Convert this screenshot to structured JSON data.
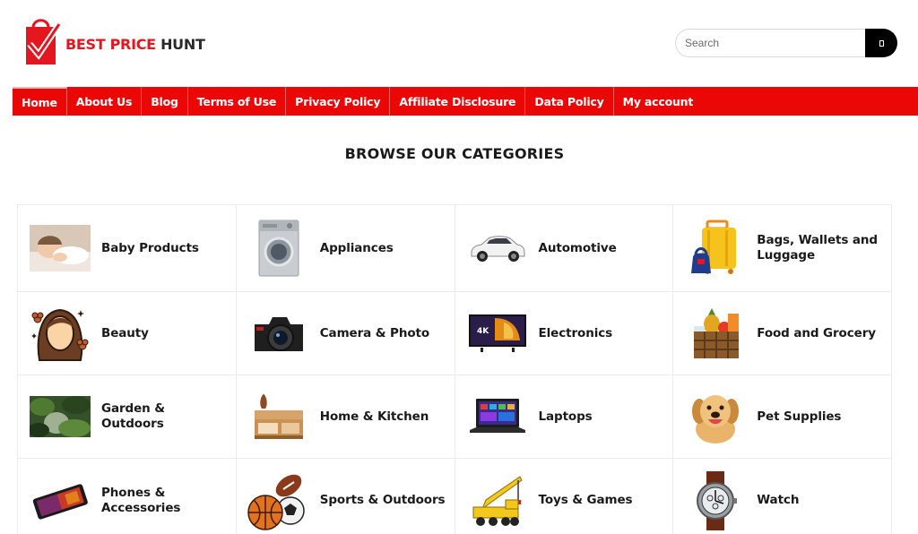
{
  "brand": {
    "name_part1": "BEST PRICE",
    "name_part2": "HUNT",
    "primary_color": "#ec0707"
  },
  "search": {
    "placeholder": "Search",
    "button_icon": "search-icon"
  },
  "nav": {
    "items": [
      {
        "label": "Home",
        "active": true
      },
      {
        "label": "About Us"
      },
      {
        "label": "Blog"
      },
      {
        "label": "Terms of Use"
      },
      {
        "label": "Privacy Policy"
      },
      {
        "label": "Affiliate Disclosure"
      },
      {
        "label": "Data Policy"
      },
      {
        "label": "My account"
      }
    ]
  },
  "section": {
    "title": "BROWSE OUR CATEGORIES"
  },
  "categories": [
    {
      "label": "Baby Products",
      "icon": "baby-photo"
    },
    {
      "label": "Appliances",
      "icon": "washing-machine"
    },
    {
      "label": "Automotive",
      "icon": "car"
    },
    {
      "label": "Bags, Wallets and Luggage",
      "icon": "luggage"
    },
    {
      "label": "Beauty",
      "icon": "woman-face"
    },
    {
      "label": "Camera & Photo",
      "icon": "camera"
    },
    {
      "label": "Electronics",
      "icon": "television"
    },
    {
      "label": "Food and Grocery",
      "icon": "grocery-basket"
    },
    {
      "label": "Garden & Outdoors",
      "icon": "garden-photo"
    },
    {
      "label": "Home & Kitchen",
      "icon": "coffee-table"
    },
    {
      "label": "Laptops",
      "icon": "laptop"
    },
    {
      "label": "Pet Supplies",
      "icon": "dog"
    },
    {
      "label": "Phones & Accessories",
      "icon": "smartphone"
    },
    {
      "label": "Sports & Outdoors",
      "icon": "sports-balls"
    },
    {
      "label": "Toys & Games",
      "icon": "toy-crane"
    },
    {
      "label": "Watch",
      "icon": "wristwatch"
    }
  ]
}
